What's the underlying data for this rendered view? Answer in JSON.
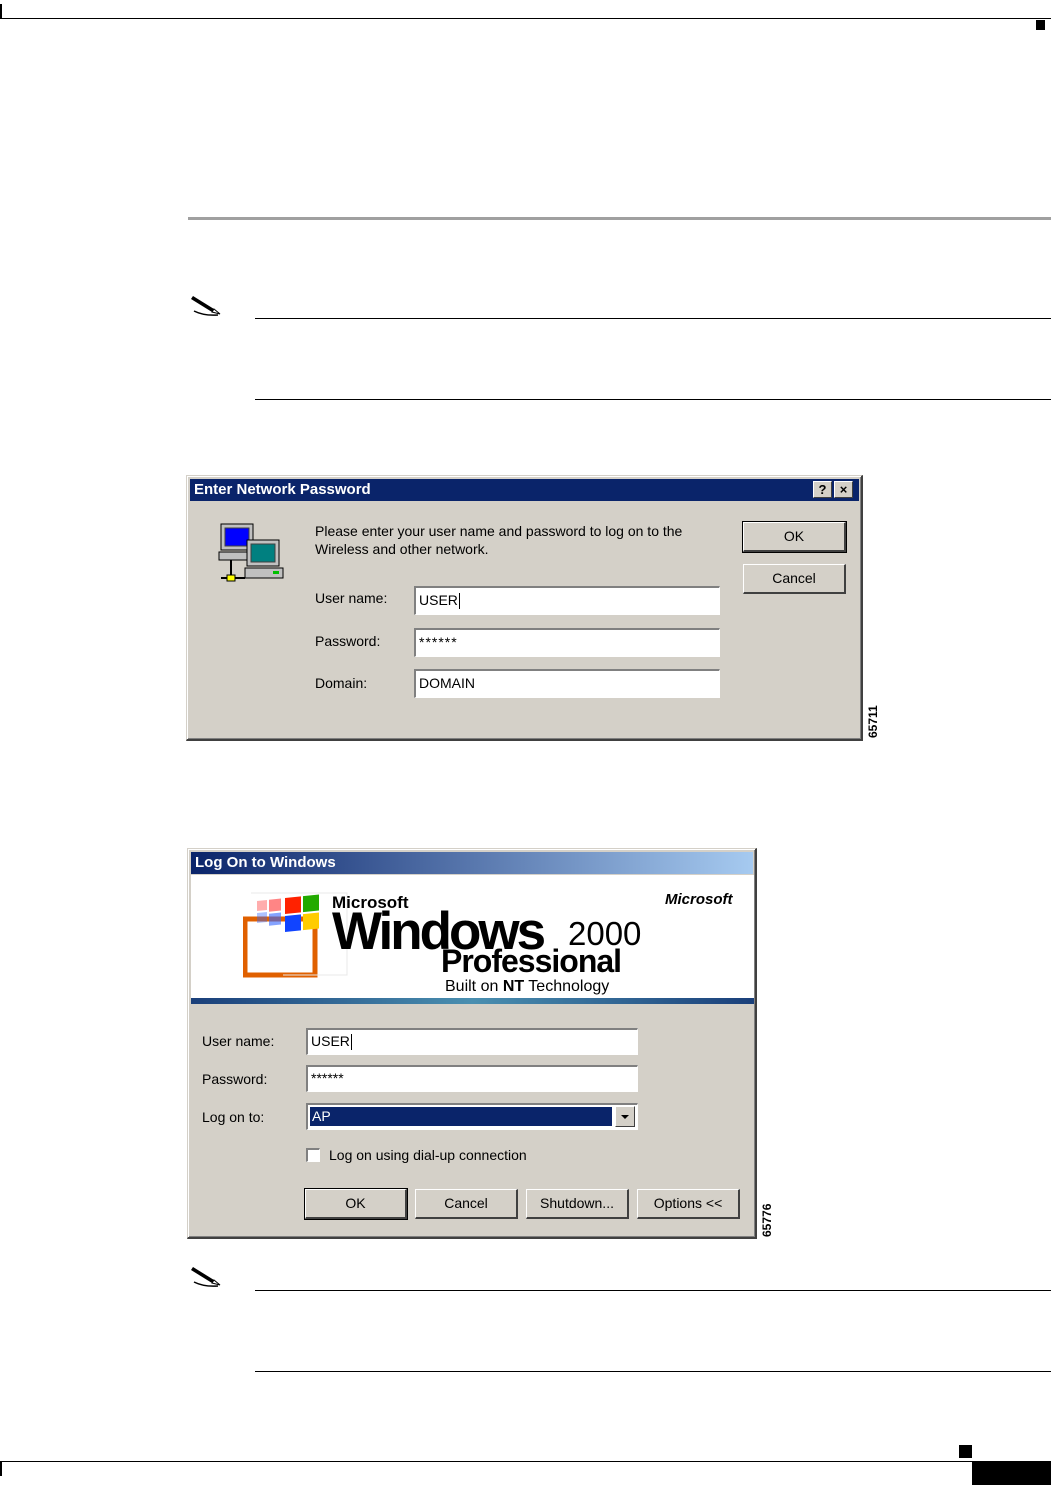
{
  "figure_ids": [
    "65711",
    "65776"
  ],
  "network_dialog": {
    "title": "Enter Network Password",
    "help_glyph": "?",
    "close_glyph": "×",
    "prompt_line1": "Please enter your user name and password to log on to the",
    "prompt_line2": "Wireless and other network.",
    "ok_label": "OK",
    "cancel_label": "Cancel",
    "username_label": "User name:",
    "password_label": "Password:",
    "domain_label": "Domain:",
    "username_value": "USER",
    "password_value": "******",
    "domain_value": "DOMAIN"
  },
  "logon_dialog": {
    "title": "Log On to Windows",
    "banner": {
      "microsoft_small": "Microsoft",
      "windows": "Windows",
      "version": "2000",
      "edition": "Professional",
      "built_prefix": "Built on ",
      "built_nt": "NT",
      "built_suffix": " Technology",
      "corp_logo": "Microsoft"
    },
    "username_label": "User name:",
    "password_label": "Password:",
    "logon_to_label": "Log on to:",
    "username_value": "USER",
    "password_value": "******",
    "logon_to_value": "AP",
    "dialup_label": "Log on using dial-up connection",
    "ok_label": "OK",
    "cancel_label": "Cancel",
    "shutdown_label": "Shutdown...",
    "options_label": "Options <<"
  }
}
